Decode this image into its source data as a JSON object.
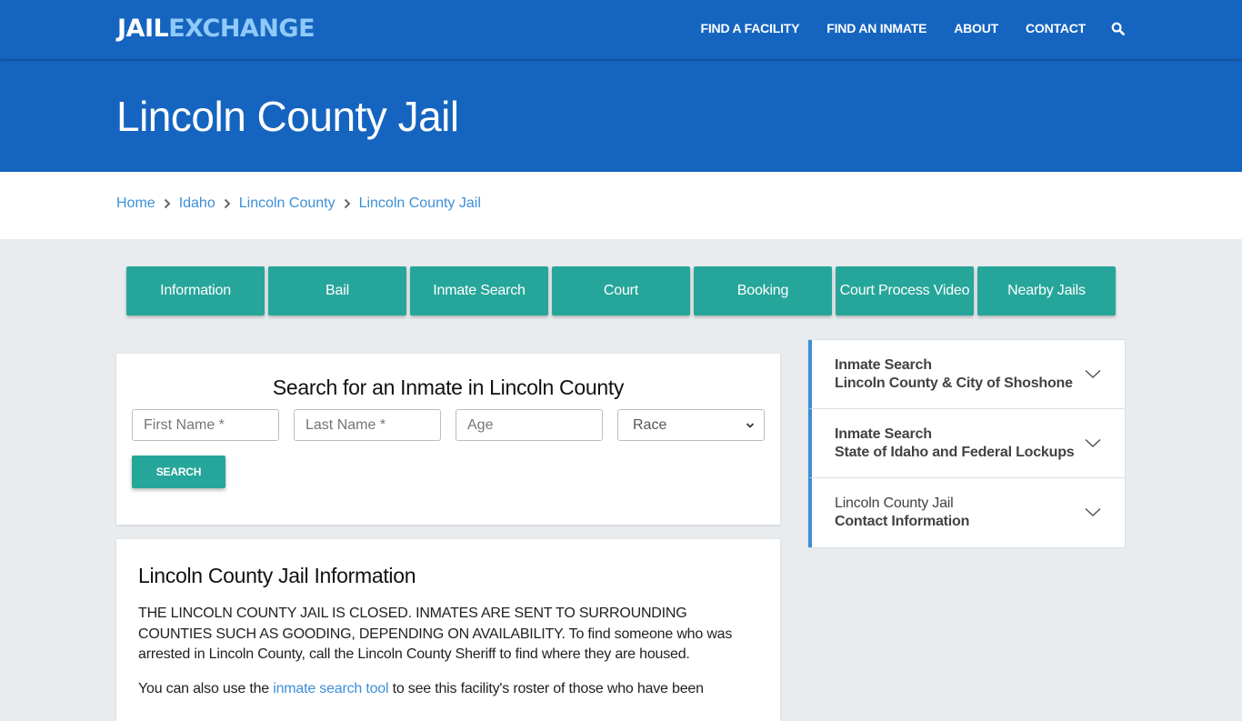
{
  "nav": {
    "logo": {
      "part1": "JAIL",
      "part2": "EXCHANGE"
    },
    "links": [
      {
        "label": "FIND A FACILITY"
      },
      {
        "label": "FIND AN INMATE"
      },
      {
        "label": "ABOUT"
      },
      {
        "label": "CONTACT"
      }
    ],
    "search_icon": "search-icon"
  },
  "hero": {
    "title": "Lincoln County Jail"
  },
  "breadcrumb": [
    {
      "label": "Home"
    },
    {
      "label": "Idaho"
    },
    {
      "label": "Lincoln County"
    },
    {
      "label": "Lincoln County Jail"
    }
  ],
  "tabs": [
    {
      "label": "Information"
    },
    {
      "label": "Bail"
    },
    {
      "label": "Inmate Search"
    },
    {
      "label": "Court"
    },
    {
      "label": "Booking"
    },
    {
      "label": "Court Process Video"
    },
    {
      "label": "Nearby Jails"
    }
  ],
  "search_form": {
    "title": "Search for an Inmate in Lincoln County",
    "first_name": {
      "placeholder": "First Name *",
      "value": ""
    },
    "last_name": {
      "placeholder": "Last Name *",
      "value": ""
    },
    "age": {
      "placeholder": "Age",
      "value": ""
    },
    "race": {
      "selected": "Race"
    },
    "submit_label": "SEARCH"
  },
  "info": {
    "title": "Lincoln County Jail Information",
    "paragraph1": "THE LINCOLN COUNTY JAIL IS CLOSED.  INMATES ARE SENT TO SURROUNDING COUNTIES SUCH AS GOODING, DEPENDING ON AVAILABILITY.  To find someone who was arrested in Lincoln County, call the Lincoln County Sheriff to find where they are housed.",
    "paragraph2_before": "You can also use the ",
    "paragraph2_link": "inmate search tool",
    "paragraph2_after": " to see this facility's roster of those who have been"
  },
  "sidebar": {
    "items": [
      {
        "line1": "Inmate Search",
        "line2": "Lincoln County & City of Shoshone",
        "line1_bold": true
      },
      {
        "line1": "Inmate Search",
        "line2": "State of Idaho and Federal Lockups",
        "line1_bold": true
      },
      {
        "line1": "Lincoln County Jail",
        "line2": "Contact Information",
        "line1_bold": false
      }
    ]
  },
  "colors": {
    "primary": "#1565c0",
    "logo_accent": "#90caf9",
    "teal": "#26a69a",
    "link": "#3d8fd8",
    "page_bg": "#e9ecef"
  }
}
